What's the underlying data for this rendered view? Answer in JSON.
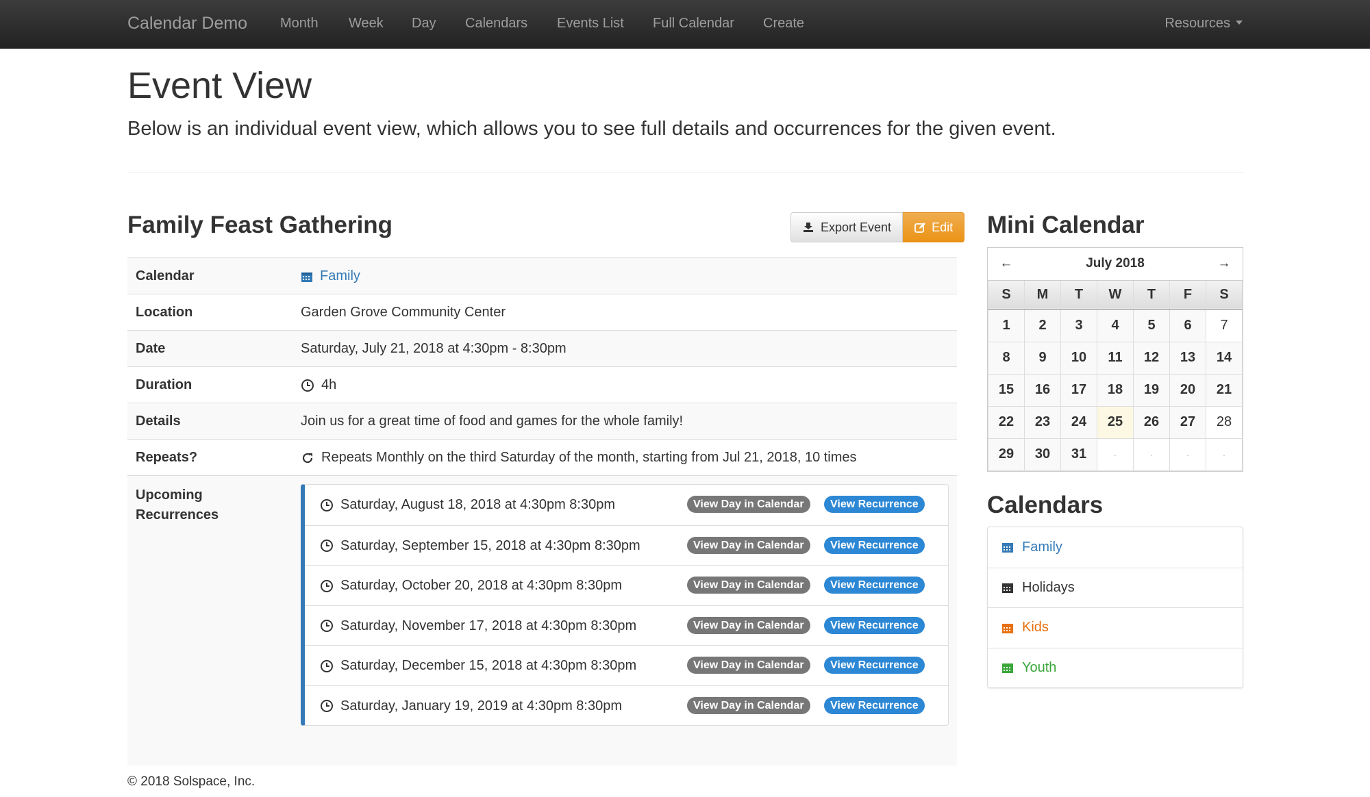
{
  "navbar": {
    "brand": "Calendar Demo",
    "links": [
      "Month",
      "Week",
      "Day",
      "Calendars",
      "Events List",
      "Full Calendar",
      "Create"
    ],
    "resources": "Resources"
  },
  "header": {
    "title": "Event View",
    "lead": "Below is an individual event view, which allows you to see full details and occurrences for the given event."
  },
  "event": {
    "title": "Family Feast Gathering",
    "export_label": "Export Event",
    "edit_label": "Edit",
    "rows": {
      "calendar": {
        "label": "Calendar",
        "value": "Family"
      },
      "location": {
        "label": "Location",
        "value": "Garden Grove Community Center"
      },
      "date": {
        "label": "Date",
        "value": "Saturday, July 21, 2018 at 4:30pm - 8:30pm"
      },
      "duration": {
        "label": "Duration",
        "value": "4h"
      },
      "details": {
        "label": "Details",
        "value": "Join us for a great time of food and games for the whole family!"
      },
      "repeats": {
        "label": "Repeats?",
        "value": "Repeats Monthly on the third Saturday of the month, starting from Jul 21, 2018, 10 times"
      }
    },
    "upcoming_label_1": "Upcoming",
    "upcoming_label_2": "Recurrences",
    "view_day_label": "View Day in Calendar",
    "view_recurrence_label": "View Recurrence",
    "recurrences": [
      "Saturday, August 18, 2018 at 4:30pm 8:30pm",
      "Saturday, September 15, 2018 at 4:30pm 8:30pm",
      "Saturday, October 20, 2018 at 4:30pm 8:30pm",
      "Saturday, November 17, 2018 at 4:30pm 8:30pm",
      "Saturday, December 15, 2018 at 4:30pm 8:30pm",
      "Saturday, January 19, 2019 at 4:30pm 8:30pm"
    ]
  },
  "mini_calendar": {
    "title": "Mini Calendar",
    "month": "July 2018",
    "prev": "←",
    "next": "→",
    "weekdays": [
      "S",
      "M",
      "T",
      "W",
      "T",
      "F",
      "S"
    ],
    "weeks": [
      [
        "1",
        "2",
        "3",
        "4",
        "5",
        "6",
        "7"
      ],
      [
        "8",
        "9",
        "10",
        "11",
        "12",
        "13",
        "14"
      ],
      [
        "15",
        "16",
        "17",
        "18",
        "19",
        "20",
        "21"
      ],
      [
        "22",
        "23",
        "24",
        "25",
        "26",
        "27",
        "28"
      ],
      [
        "29",
        "30",
        "31",
        "·",
        "·",
        "·",
        "·"
      ]
    ]
  },
  "calendars": {
    "title": "Calendars",
    "items": [
      {
        "label": "Family",
        "color": "#337ab7"
      },
      {
        "label": "Holidays",
        "color": "#333333"
      },
      {
        "label": "Kids",
        "color": "#e8700f"
      },
      {
        "label": "Youth",
        "color": "#3aa63a"
      }
    ]
  },
  "footer": "© 2018 Solspace, Inc."
}
